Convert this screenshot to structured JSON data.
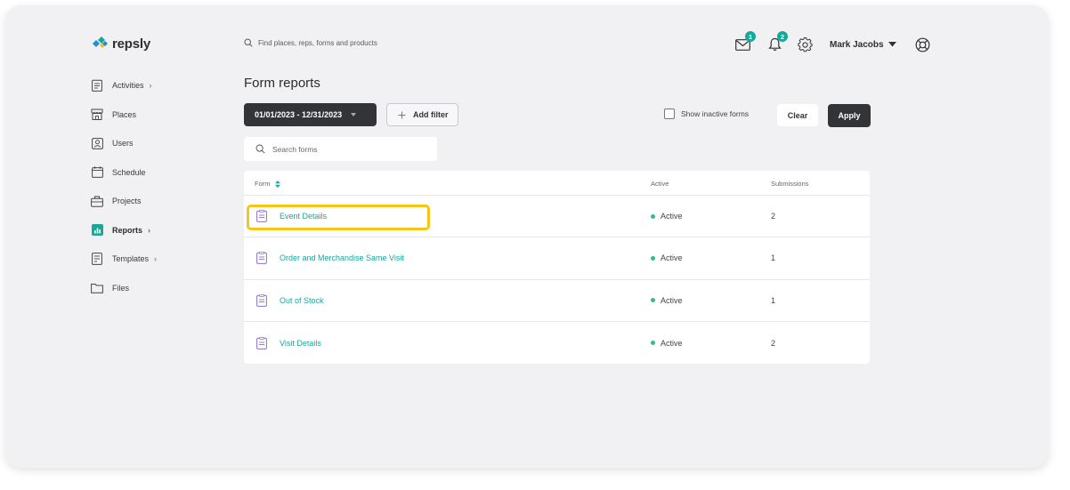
{
  "brand": {
    "name": "repsly",
    "color": "#16a89a"
  },
  "top_search": {
    "placeholder": "Find places, reps, forms and products"
  },
  "header": {
    "messages_badge": "1",
    "notifications_badge": "2",
    "user_name": "Mark Jacobs"
  },
  "sidebar": {
    "items": [
      {
        "label": "Activities",
        "icon": "clipboard-icon",
        "chevron": "›"
      },
      {
        "label": "Places",
        "icon": "storefront-icon"
      },
      {
        "label": "Users",
        "icon": "user-card-icon"
      },
      {
        "label": "Schedule",
        "icon": "calendar-icon"
      },
      {
        "label": "Projects",
        "icon": "briefcase-icon"
      },
      {
        "label": "Reports",
        "icon": "bar-chart-icon",
        "chevron": "›",
        "active": true
      },
      {
        "label": "Templates",
        "icon": "template-icon",
        "chevron": "›"
      },
      {
        "label": "Files",
        "icon": "folder-icon"
      }
    ]
  },
  "main": {
    "title": "Form reports",
    "date_range": "01/01/2023 - 12/31/2023",
    "add_filter": "Add filter",
    "show_inactive_label": "Show inactive forms",
    "clear_label": "Clear",
    "apply_label": "Apply",
    "form_search_placeholder": "Search forms",
    "table": {
      "columns": [
        "Form",
        "Active",
        "Submissions"
      ],
      "rows": [
        {
          "form": "Event Details",
          "status": "Active",
          "submissions": "2"
        },
        {
          "form": "Order and Merchandise Same Visit",
          "status": "Active",
          "submissions": "1"
        },
        {
          "form": "Out of Stock",
          "status": "Active",
          "submissions": "1"
        },
        {
          "form": "Visit Details",
          "status": "Active",
          "submissions": "2"
        }
      ]
    }
  },
  "colors": {
    "accent": "#16a89a",
    "highlight": "#f5c518",
    "dark_button": "#333438",
    "active_dot": "#2bbf8a"
  }
}
